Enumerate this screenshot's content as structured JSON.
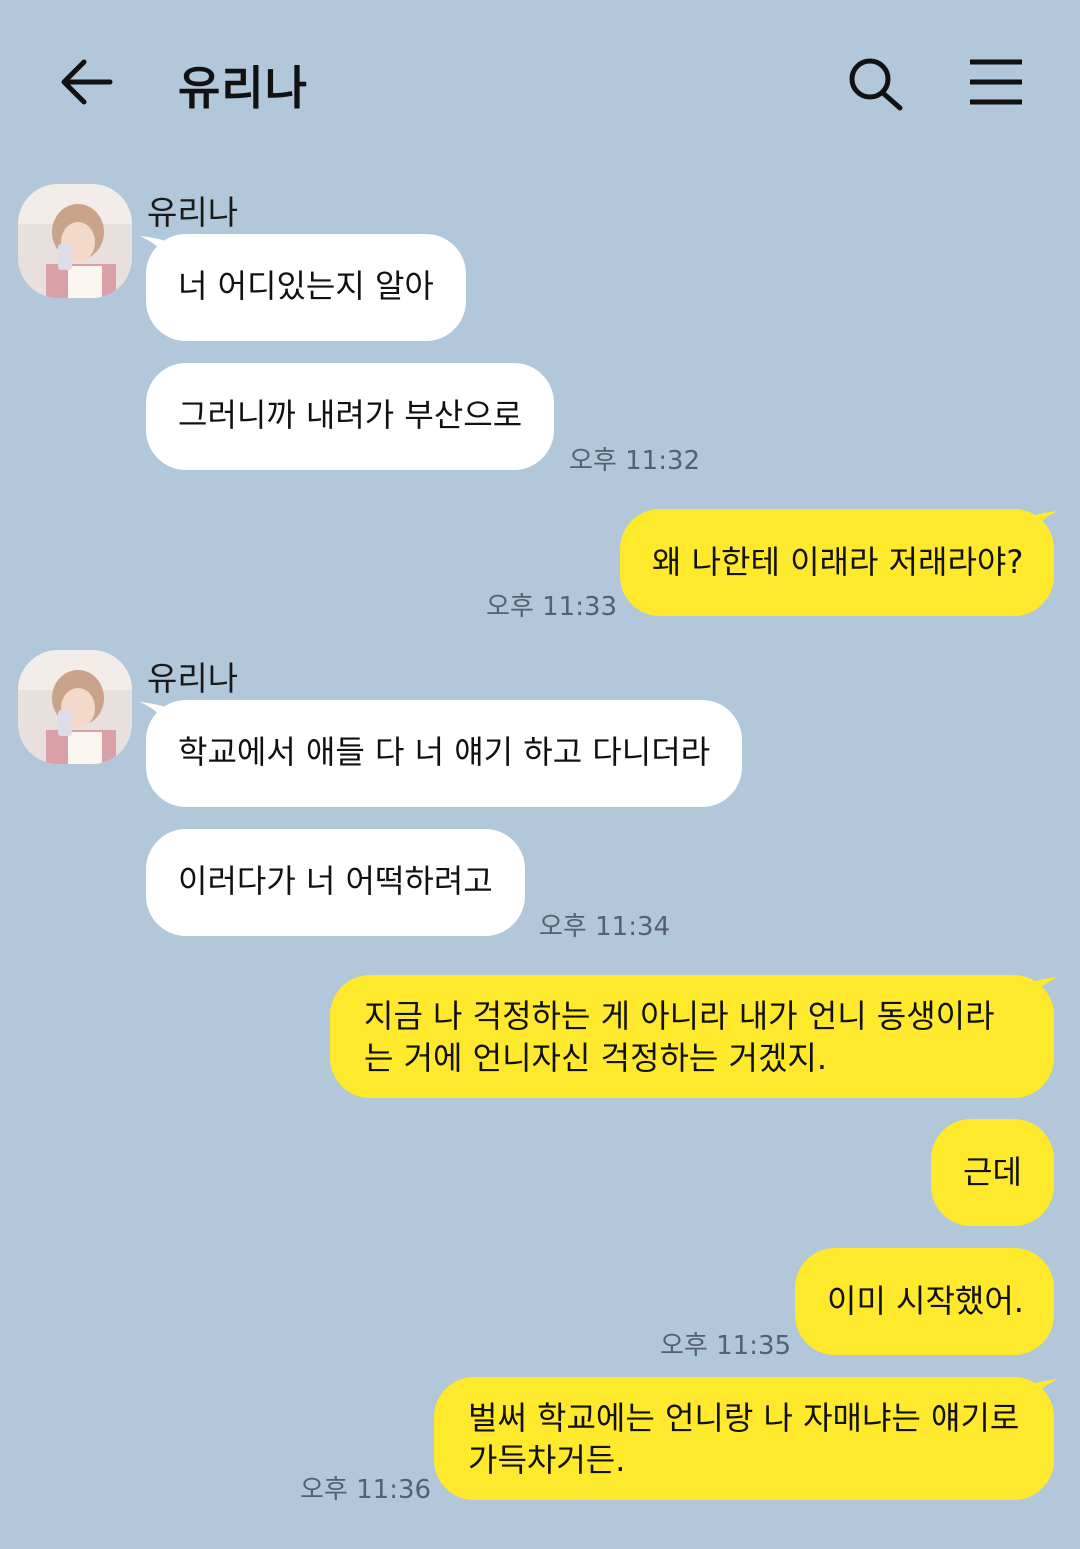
{
  "header": {
    "title": "유리나",
    "back_icon": "arrow-left-icon",
    "search_icon": "search-icon",
    "menu_icon": "hamburger-menu-icon"
  },
  "colors": {
    "background": "#b2c7da",
    "incoming_bubble": "#ffffff",
    "outgoing_bubble": "#fee92c"
  },
  "messages": {
    "group1": {
      "sender": "유리나",
      "m1": "너 어디있는지 알아",
      "m2": "그러니까 내려가 부산으로",
      "time": "오후 11:32"
    },
    "out1": {
      "m1": "왜 나한테 이래라 저래라야?",
      "time": "오후 11:33"
    },
    "group2": {
      "sender": "유리나",
      "m1": "학교에서 애들 다 너 얘기 하고 다니더라",
      "m2": "이러다가 너 어떡하려고",
      "time": "오후 11:34"
    },
    "out2": {
      "m1": "지금 나 걱정하는 게 아니라 내가 언니 동생이라는 거에 언니자신 걱정하는 거겠지.",
      "m2": "근데",
      "m3": "이미 시작했어.",
      "time": "오후 11:35"
    },
    "out3": {
      "m1": "벌써 학교에는 언니랑 나 자매냐는 얘기로 가득차거든.",
      "time": "오후 11:36"
    }
  }
}
